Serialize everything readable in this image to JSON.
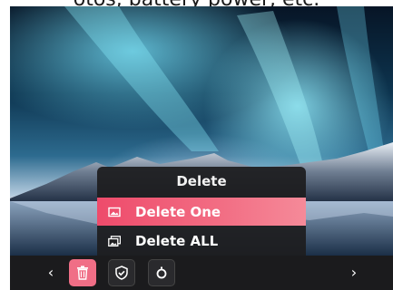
{
  "caption": "otos, battery power, etc.",
  "menu": {
    "title": "Delete",
    "items": [
      {
        "label": "Delete One",
        "icon": "single-image-icon",
        "selected": true
      },
      {
        "label": "Delete ALL",
        "icon": "multiple-images-icon",
        "selected": false
      }
    ]
  },
  "toolbar": {
    "prev": "‹",
    "next": "›",
    "tools": [
      {
        "icon": "trash-icon",
        "active": true
      },
      {
        "icon": "shield-check-icon",
        "active": false
      },
      {
        "icon": "camera-lens-icon",
        "active": false
      }
    ]
  },
  "colors": {
    "accent": "#f06e86",
    "menu_bg": "#1e1e20",
    "bar_bg": "#1b1b1d"
  }
}
